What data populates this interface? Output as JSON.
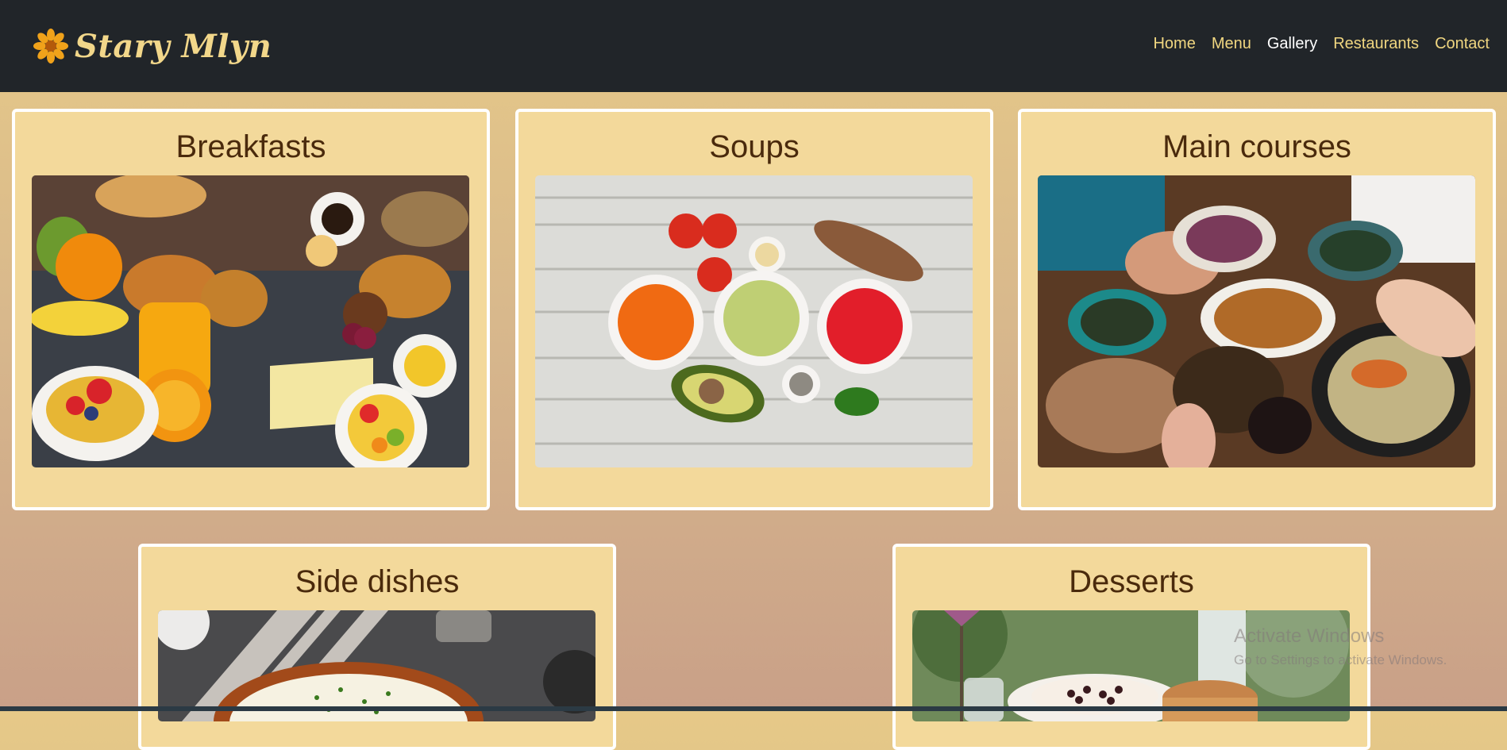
{
  "brand": {
    "name": "Stary Mlyn",
    "icon": "flower-icon"
  },
  "nav": [
    {
      "label": "Home",
      "active": false
    },
    {
      "label": "Menu",
      "active": false
    },
    {
      "label": "Gallery",
      "active": true
    },
    {
      "label": "Restaurants",
      "active": false
    },
    {
      "label": "Contact",
      "active": false
    }
  ],
  "categories": [
    {
      "title": "Breakfasts",
      "image": "breakfast-spread-photo"
    },
    {
      "title": "Soups",
      "image": "soups-on-wooden-table-photo"
    },
    {
      "title": "Main courses",
      "image": "shared-dinner-table-photo"
    },
    {
      "title": "Side dishes",
      "image": "mashed-potatoes-photo"
    },
    {
      "title": "Desserts",
      "image": "cakes-outdoor-photo"
    }
  ],
  "watermark": {
    "line1": "Activate Windows",
    "line2": "Go to Settings to activate Windows."
  },
  "colors": {
    "navbar": "#212529",
    "accent": "#f0d680",
    "card": "#f3d99b",
    "heading": "#4a2a0c"
  }
}
